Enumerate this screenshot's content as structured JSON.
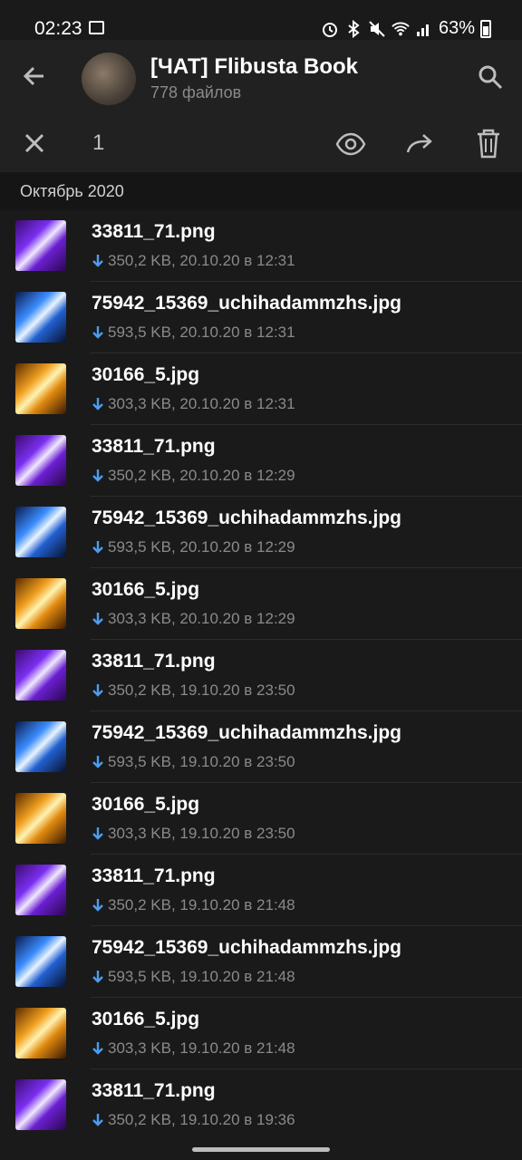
{
  "status_bar": {
    "time": "02:23",
    "battery": "63%",
    "icons": [
      "gallery-icon",
      "alarm-icon",
      "bluetooth-icon",
      "mute-icon",
      "wifi-icon",
      "signal-icon",
      "battery-icon"
    ]
  },
  "header": {
    "title": "[ЧАТ] Flibusta Book",
    "subtitle": "778 файлов"
  },
  "selection": {
    "count": "1"
  },
  "month_header": "Октябрь 2020",
  "colors": {
    "background": "#1a1a1a",
    "header": "#212121",
    "download_accent": "#4a9ef0"
  },
  "files": [
    {
      "name": "33811_71.png",
      "meta": "350,2 KB, 20.10.20 в 12:31",
      "thumb": "png"
    },
    {
      "name": "75942_15369_uchihadammzhs.jpg",
      "meta": "593,5 KB, 20.10.20 в 12:31",
      "thumb": "sas"
    },
    {
      "name": "30166_5.jpg",
      "meta": "303,3 KB, 20.10.20 в 12:31",
      "thumb": "nar"
    },
    {
      "name": "33811_71.png",
      "meta": "350,2 KB, 20.10.20 в 12:29",
      "thumb": "png"
    },
    {
      "name": "75942_15369_uchihadammzhs.jpg",
      "meta": "593,5 KB, 20.10.20 в 12:29",
      "thumb": "sas"
    },
    {
      "name": "30166_5.jpg",
      "meta": "303,3 KB, 20.10.20 в 12:29",
      "thumb": "nar"
    },
    {
      "name": "33811_71.png",
      "meta": "350,2 KB, 19.10.20 в 23:50",
      "thumb": "png"
    },
    {
      "name": "75942_15369_uchihadammzhs.jpg",
      "meta": "593,5 KB, 19.10.20 в 23:50",
      "thumb": "sas"
    },
    {
      "name": "30166_5.jpg",
      "meta": "303,3 KB, 19.10.20 в 23:50",
      "thumb": "nar"
    },
    {
      "name": "33811_71.png",
      "meta": "350,2 KB, 19.10.20 в 21:48",
      "thumb": "png"
    },
    {
      "name": "75942_15369_uchihadammzhs.jpg",
      "meta": "593,5 KB, 19.10.20 в 21:48",
      "thumb": "sas"
    },
    {
      "name": "30166_5.jpg",
      "meta": "303,3 KB, 19.10.20 в 21:48",
      "thumb": "nar"
    },
    {
      "name": "33811_71.png",
      "meta": "350,2 KB, 19.10.20 в 19:36",
      "thumb": "png"
    }
  ]
}
